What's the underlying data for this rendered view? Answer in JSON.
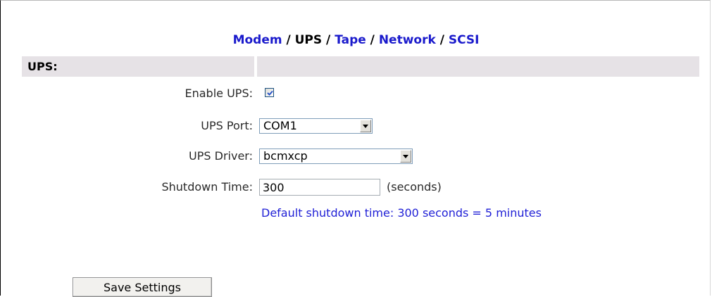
{
  "subnav": {
    "modem": "Modem",
    "ups": "UPS",
    "tape": "Tape",
    "network": "Network",
    "scsi": "SCSI",
    "separator": " / "
  },
  "section": {
    "title": "UPS:"
  },
  "form": {
    "enable_ups_label": "Enable UPS:",
    "enable_ups_checked": true,
    "ups_port_label": "UPS Port:",
    "ups_port_value": "COM1",
    "ups_driver_label": "UPS Driver:",
    "ups_driver_value": "bcmxcp",
    "shutdown_time_label": "Shutdown Time:",
    "shutdown_time_value": "300",
    "shutdown_time_unit": "(seconds)",
    "default_note": "Default shutdown time: 300 seconds = 5 minutes"
  },
  "actions": {
    "save_label": "Save Settings"
  },
  "colors": {
    "link": "#1a1acc",
    "note": "#1f1fd6",
    "header_bg": "#e6e2e6",
    "checkbox_check": "#2a55c8"
  }
}
